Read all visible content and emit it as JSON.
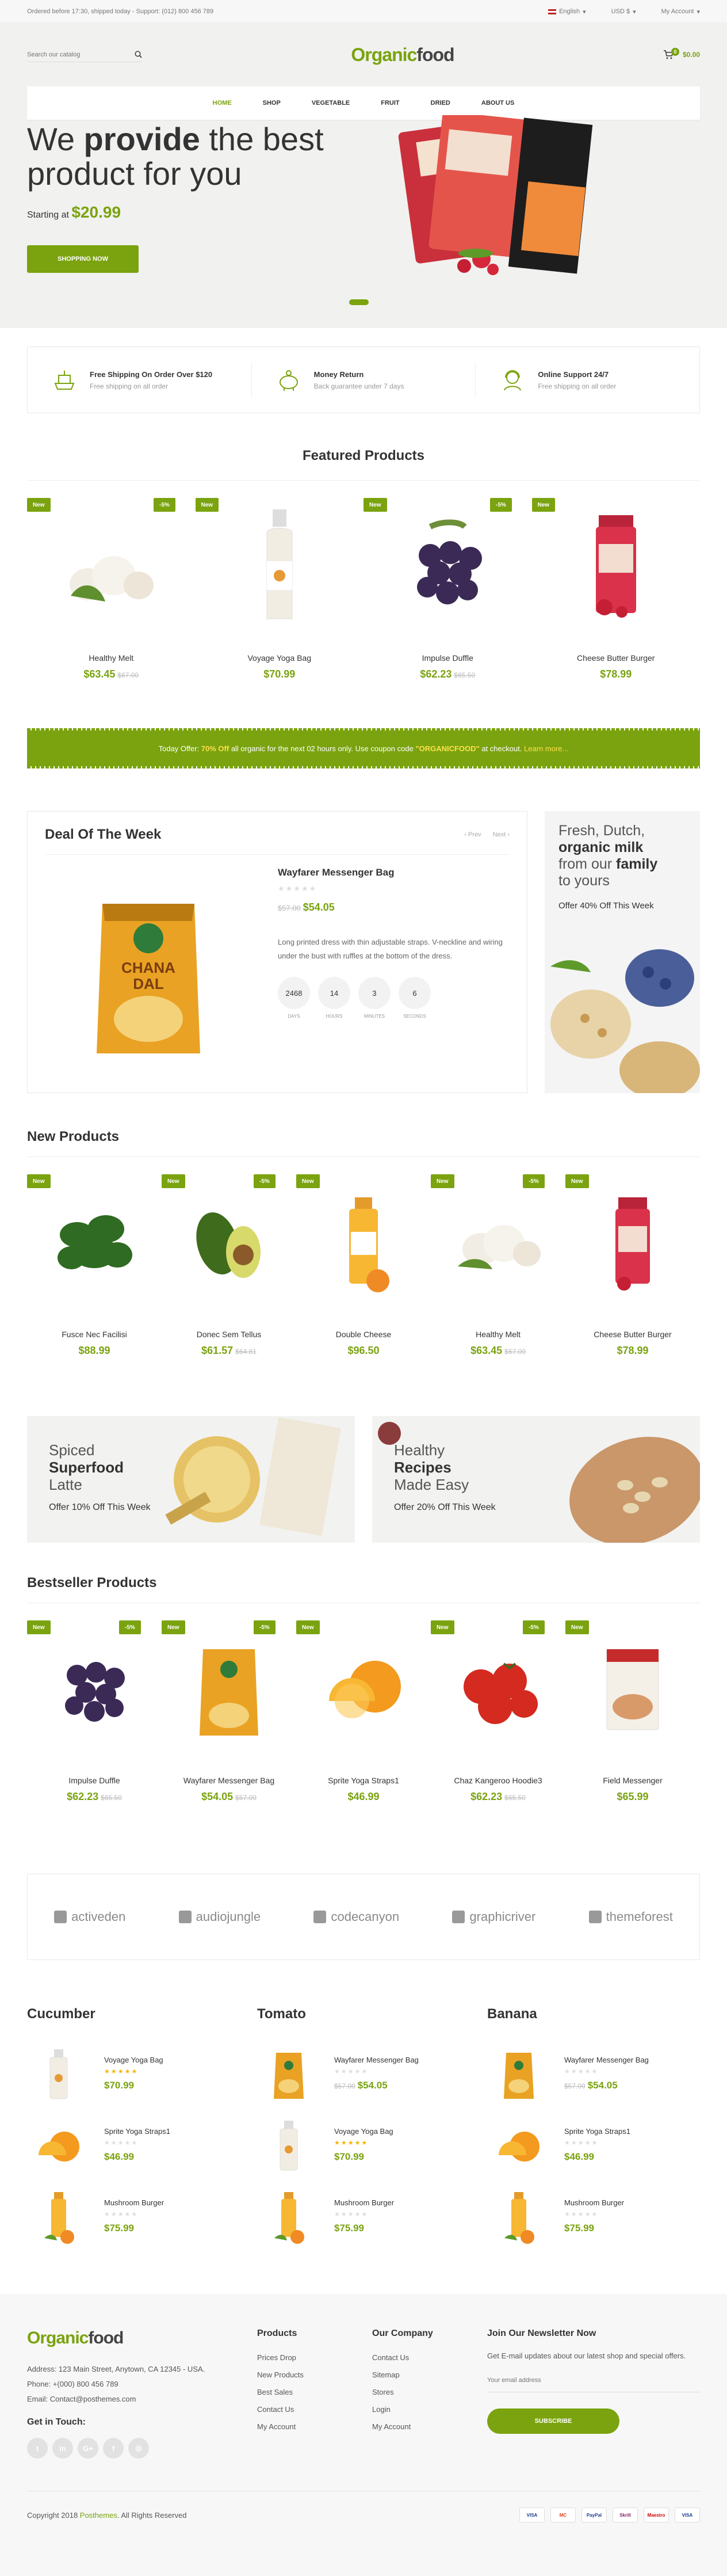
{
  "topbar": {
    "notice": "Ordered before 17:30, shipped today - Support: (012) 800 456 789",
    "language": "English",
    "currency": "USD $",
    "account": "My Account"
  },
  "header": {
    "search_placeholder": "Search our catalog",
    "logo_a": "Organic",
    "logo_b": "food",
    "cart_count": "0",
    "cart_total": "$0.00"
  },
  "nav": [
    "Home",
    "Shop",
    "Vegetable",
    "Fruit",
    "Dried",
    "About Us"
  ],
  "hero": {
    "line1_a": "We ",
    "line1_b": "provide",
    "line1_c": " the best",
    "line2": "product for you",
    "start_label": "Starting at ",
    "price": "$20.99",
    "button": "Shopping Now"
  },
  "features": [
    {
      "title": "Free Shipping On Order Over $120",
      "desc": "Free shipping on all order",
      "icon": "ship-icon"
    },
    {
      "title": "Money Return",
      "desc": "Back guarantee under 7 days",
      "icon": "piggy-bank-icon"
    },
    {
      "title": "Online Support 24/7",
      "desc": "Free shipping on all order",
      "icon": "support-icon"
    }
  ],
  "featured": {
    "title": "Featured Products",
    "items": [
      {
        "badge": "New",
        "sale": "-5%",
        "name": "Healthy Melt",
        "price": "$63.45",
        "old": "$67.00"
      },
      {
        "badge": "New",
        "sale": "",
        "name": "Voyage Yoga Bag",
        "price": "$70.99",
        "old": ""
      },
      {
        "badge": "New",
        "sale": "-5%",
        "name": "Impulse Duffle",
        "price": "$62.23",
        "old": "$65.50"
      },
      {
        "badge": "New",
        "sale": "",
        "name": "Cheese Butter Burger",
        "price": "$78.99",
        "old": ""
      }
    ]
  },
  "offer": {
    "a": "Today Offer: ",
    "b": "70% Off",
    "c": " all organic for the next 02 hours only. Use coupon code ",
    "d": "\"ORGANICFOOD\"",
    "e": " at checkout. ",
    "f": "Learn more..."
  },
  "deal": {
    "title": "Deal Of The Week",
    "prev": "‹ Prev",
    "next": "Next ›",
    "name": "Wayfarer Messenger Bag",
    "old": "$57.00",
    "price": "$54.05",
    "desc": "Long printed dress with thin adjustable straps. V-neckline and wiring under the bust with ruffles at the bottom of the dress.",
    "countdown": [
      {
        "v": "2468",
        "l": "Days"
      },
      {
        "v": "14",
        "l": "Hours"
      },
      {
        "v": "3",
        "l": "Minutes"
      },
      {
        "v": "6",
        "l": "Seconds"
      }
    ],
    "pack_top": "CHANA",
    "pack_bottom": "DAL"
  },
  "deal_side": {
    "l1": "Fresh, Dutch,",
    "l2": "organic milk",
    "l3a": "from our ",
    "l3b": "family",
    "l4": "to yours",
    "sub": "Offer 40% Off This Week"
  },
  "new_products": {
    "title": "New Products",
    "items": [
      {
        "badge": "New",
        "sale": "",
        "name": "Fusce Nec Facilisi",
        "price": "$88.99",
        "old": ""
      },
      {
        "badge": "New",
        "sale": "-5%",
        "name": "Donec Sem Tellus",
        "price": "$61.57",
        "old": "$64.81"
      },
      {
        "badge": "New",
        "sale": "",
        "name": "Double Cheese",
        "price": "$96.50",
        "old": ""
      },
      {
        "badge": "New",
        "sale": "-5%",
        "name": "Healthy Melt",
        "price": "$63.45",
        "old": "$67.00"
      },
      {
        "badge": "New",
        "sale": "",
        "name": "Cheese Butter Burger",
        "price": "$78.99",
        "old": ""
      }
    ]
  },
  "banners": [
    {
      "a": "Spiced",
      "b": "Superfood",
      "c": "Latte",
      "sub": "Offer 10% Off This Week"
    },
    {
      "a": "Healthy",
      "b": "Recipes",
      "c": "Made Easy",
      "sub": "Offer 20% Off This Week"
    }
  ],
  "bestseller": {
    "title": "Bestseller Products",
    "items": [
      {
        "badge": "New",
        "sale": "-5%",
        "name": "Impulse Duffle",
        "price": "$62.23",
        "old": "$65.50"
      },
      {
        "badge": "New",
        "sale": "-5%",
        "name": "Wayfarer Messenger Bag",
        "price": "$54.05",
        "old": "$57.00"
      },
      {
        "badge": "New",
        "sale": "",
        "name": "Sprite Yoga Straps1",
        "price": "$46.99",
        "old": ""
      },
      {
        "badge": "New",
        "sale": "-5%",
        "name": "Chaz Kangeroo Hoodie3",
        "price": "$62.23",
        "old": "$65.50"
      },
      {
        "badge": "New",
        "sale": "",
        "name": "Field Messenger",
        "price": "$65.99",
        "old": ""
      }
    ]
  },
  "brands": [
    "activeden",
    "audiojungle",
    "codecanyon",
    "graphicriver",
    "themeforest"
  ],
  "columns": [
    {
      "title": "Cucumber",
      "items": [
        {
          "name": "Voyage Yoga Bag",
          "price": "$70.99",
          "old": "",
          "rated": true
        },
        {
          "name": "Sprite Yoga Straps1",
          "price": "$46.99",
          "old": "",
          "rated": false
        },
        {
          "name": "Mushroom Burger",
          "price": "$75.99",
          "old": "",
          "rated": false
        }
      ]
    },
    {
      "title": "Tomato",
      "items": [
        {
          "name": "Wayfarer Messenger Bag",
          "price": "$54.05",
          "old": "$57.00",
          "rated": false
        },
        {
          "name": "Voyage Yoga Bag",
          "price": "$70.99",
          "old": "",
          "rated": true
        },
        {
          "name": "Mushroom Burger",
          "price": "$75.99",
          "old": "",
          "rated": false
        }
      ]
    },
    {
      "title": "Banana",
      "items": [
        {
          "name": "Wayfarer Messenger Bag",
          "price": "$54.05",
          "old": "$57.00",
          "rated": false
        },
        {
          "name": "Sprite Yoga Straps1",
          "price": "$46.99",
          "old": "",
          "rated": false
        },
        {
          "name": "Mushroom Burger",
          "price": "$75.99",
          "old": "",
          "rated": false
        }
      ]
    }
  ],
  "footer": {
    "address": "Address: 123 Main Street, Anytown, CA 12345 - USA.",
    "phone": "Phone: +(000) 800 456 789",
    "email": "Email: Contact@posthemes.com",
    "get_in_touch": "Get in Touch:",
    "socials": [
      "t",
      "in",
      "G+",
      "f",
      "◎"
    ],
    "products_title": "Products",
    "products": [
      "Prices Drop",
      "New Products",
      "Best Sales",
      "Contact Us",
      "My Account"
    ],
    "company_title": "Our Company",
    "company": [
      "Contact Us",
      "Sitemap",
      "Stores",
      "Login",
      "My Account"
    ],
    "news_title": "Join Our Newsletter Now",
    "news_desc": "Get E-mail updates about our latest shop and special offers.",
    "news_placeholder": "Your email address",
    "subscribe": "Subscribe",
    "copy_a": "Copyright 2018 ",
    "copy_b": "Posthemes",
    "copy_c": ". All Rights Reserved",
    "pays": [
      "VISA",
      "MC",
      "PayPal",
      "Skrill",
      "Maestro",
      "VISA"
    ]
  },
  "colors": {
    "accent": "#7aa30f",
    "sale": "#7aa30f",
    "star": "#f5b400"
  }
}
